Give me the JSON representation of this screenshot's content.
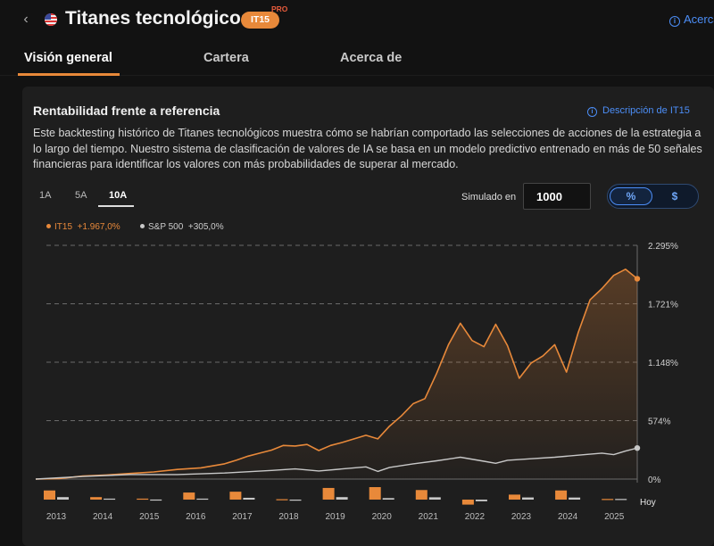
{
  "header": {
    "title": "Titanes tecnológicos",
    "ticker": "IT15",
    "pro": "PRO",
    "about": "Acerca"
  },
  "tabs": [
    {
      "label": "Visión general",
      "active": true
    },
    {
      "label": "Cartera",
      "active": false
    },
    {
      "label": "Acerca de",
      "active": false
    }
  ],
  "card": {
    "title": "Rentabilidad frente a referencia",
    "desc_link": "Descripción de IT15",
    "description": "Este backtesting histórico de Titanes tecnológicos muestra cómo se habrían comportado las selecciones de acciones de la estrategia a lo largo del tiempo. Nuestro sistema de clasificación de valores de IA se basa en un modelo predictivo entrenado en más de 50 señales financieras para identificar los valores con más probabilidades de superar al mercado.",
    "ranges": [
      "1A",
      "5A",
      "10A"
    ],
    "active_range": "10A",
    "simulate_label": "Simulado en",
    "simulate_value": "1000",
    "toggle": [
      "%",
      "$"
    ],
    "active_toggle": "%"
  },
  "colors": {
    "accent": "#e8893a",
    "benchmark": "#c8c8c8",
    "link": "#4c8ef7",
    "background": "#121212",
    "card": "#1e1e1e"
  },
  "chart_data": {
    "type": "line",
    "series": [
      {
        "name": "IT15",
        "return_label": "+1.967,0%",
        "color": "#e8893a",
        "points": [
          [
            "2012-12",
            0
          ],
          [
            "2013-06",
            5
          ],
          [
            "2013-12",
            30
          ],
          [
            "2014-06",
            40
          ],
          [
            "2014-12",
            55
          ],
          [
            "2015-06",
            70
          ],
          [
            "2015-12",
            95
          ],
          [
            "2016-06",
            110
          ],
          [
            "2016-12",
            150
          ],
          [
            "2017-03",
            185
          ],
          [
            "2017-06",
            225
          ],
          [
            "2017-09",
            255
          ],
          [
            "2017-12",
            285
          ],
          [
            "2018-03",
            330
          ],
          [
            "2018-06",
            325
          ],
          [
            "2018-09",
            340
          ],
          [
            "2018-12",
            280
          ],
          [
            "2019-03",
            330
          ],
          [
            "2019-06",
            360
          ],
          [
            "2019-09",
            395
          ],
          [
            "2019-12",
            430
          ],
          [
            "2020-03",
            395
          ],
          [
            "2020-06",
            520
          ],
          [
            "2020-09",
            620
          ],
          [
            "2020-12",
            740
          ],
          [
            "2021-03",
            790
          ],
          [
            "2021-06",
            1040
          ],
          [
            "2021-09",
            1320
          ],
          [
            "2021-12",
            1530
          ],
          [
            "2022-03",
            1360
          ],
          [
            "2022-06",
            1300
          ],
          [
            "2022-09",
            1520
          ],
          [
            "2022-12",
            1310
          ],
          [
            "2023-03",
            990
          ],
          [
            "2023-06",
            1140
          ],
          [
            "2023-09",
            1210
          ],
          [
            "2023-12",
            1320
          ],
          [
            "2024-03",
            1050
          ],
          [
            "2024-06",
            1440
          ],
          [
            "2024-09",
            1760
          ],
          [
            "2024-12",
            1870
          ],
          [
            "2025-03",
            2000
          ],
          [
            "2025-06",
            2060
          ],
          [
            "2025-09",
            1967
          ]
        ]
      },
      {
        "name": "S&P 500",
        "return_label": "+305,0%",
        "color": "#c8c8c8",
        "points": [
          [
            "2012-12",
            0
          ],
          [
            "2013-12",
            25
          ],
          [
            "2014-12",
            45
          ],
          [
            "2015-12",
            45
          ],
          [
            "2016-12",
            60
          ],
          [
            "2017-12",
            85
          ],
          [
            "2018-06",
            100
          ],
          [
            "2018-12",
            80
          ],
          [
            "2019-06",
            100
          ],
          [
            "2019-12",
            120
          ],
          [
            "2020-03",
            75
          ],
          [
            "2020-06",
            115
          ],
          [
            "2020-12",
            150
          ],
          [
            "2021-06",
            180
          ],
          [
            "2021-12",
            215
          ],
          [
            "2022-06",
            175
          ],
          [
            "2022-09",
            155
          ],
          [
            "2022-12",
            185
          ],
          [
            "2023-06",
            200
          ],
          [
            "2023-12",
            215
          ],
          [
            "2024-06",
            235
          ],
          [
            "2024-12",
            255
          ],
          [
            "2025-03",
            240
          ],
          [
            "2025-06",
            275
          ],
          [
            "2025-09",
            305
          ]
        ]
      }
    ],
    "yticks": [
      "2.295%",
      "1.721%",
      "1.148%",
      "574%",
      "0%"
    ],
    "ylim": [
      0,
      2295
    ],
    "annual_returns": [
      {
        "year": "2013",
        "it15": 110,
        "sp500": 30
      },
      {
        "year": "2014",
        "it15": 30,
        "sp500": 12
      },
      {
        "year": "2015",
        "it15": 12,
        "sp500": 1
      },
      {
        "year": "2016",
        "it15": 85,
        "sp500": 12
      },
      {
        "year": "2017",
        "it15": 95,
        "sp500": 22
      },
      {
        "year": "2018",
        "it15": 5,
        "sp500": -5
      },
      {
        "year": "2019",
        "it15": 140,
        "sp500": 30
      },
      {
        "year": "2020",
        "it15": 150,
        "sp500": 18
      },
      {
        "year": "2021",
        "it15": 115,
        "sp500": 28
      },
      {
        "year": "2022",
        "it15": -60,
        "sp500": -20
      },
      {
        "year": "2023",
        "it15": 60,
        "sp500": 26
      },
      {
        "year": "2024",
        "it15": 110,
        "sp500": 25
      },
      {
        "year": "2025",
        "it15": 8,
        "sp500": 8
      }
    ],
    "x_end_label": "Hoy",
    "legend": "top-left",
    "grid": true
  }
}
